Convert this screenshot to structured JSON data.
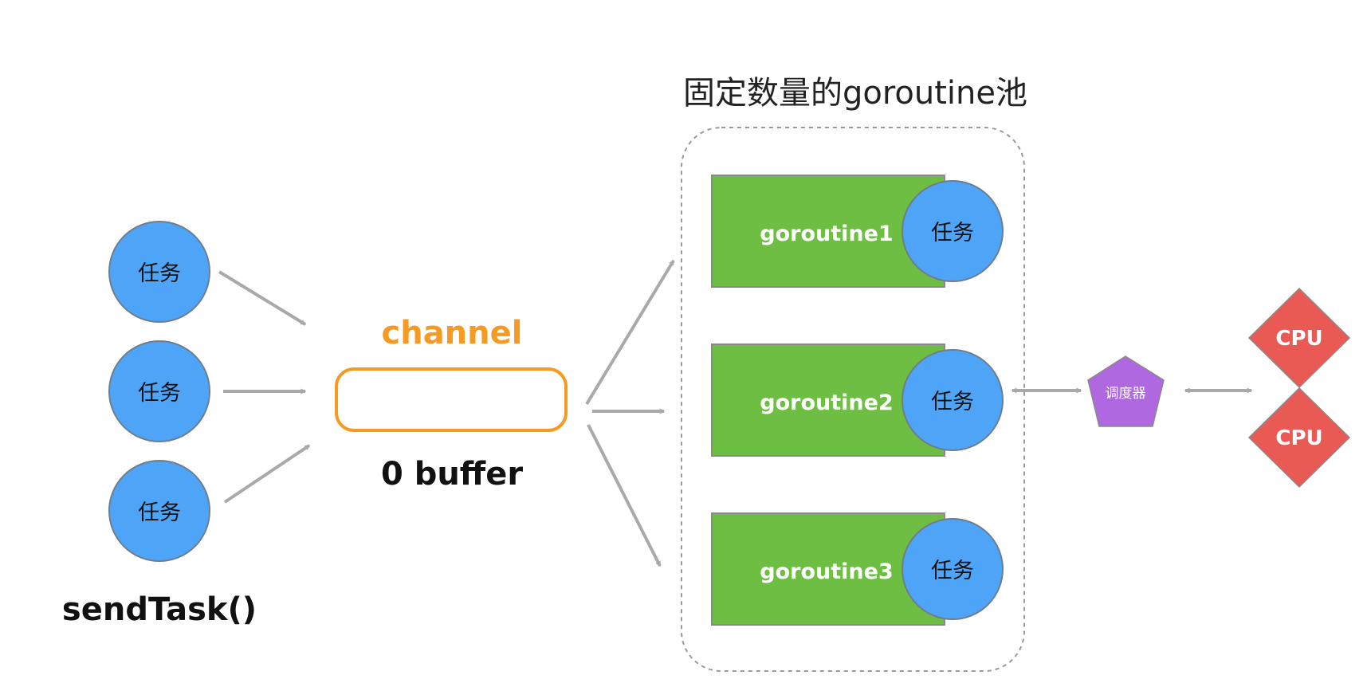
{
  "pool": {
    "title": "固定数量的goroutine池"
  },
  "producer": {
    "tasks": [
      "任务",
      "任务",
      "任务"
    ],
    "caption": "sendTask()"
  },
  "channel": {
    "label": "channel",
    "buffer_label": "0 buffer"
  },
  "workers": [
    {
      "name": "goroutine1",
      "task": "任务"
    },
    {
      "name": "goroutine2",
      "task": "任务"
    },
    {
      "name": "goroutine3",
      "task": "任务"
    }
  ],
  "scheduler": {
    "label": "调度器"
  },
  "cpus": [
    "CPU",
    "CPU"
  ],
  "colors": {
    "task_fill": "#4ea5f8",
    "task_stroke": "#6e7d8c",
    "worker_fill": "#6fbe44",
    "worker_stroke": "#8a8a8a",
    "channel_stroke": "#f59a23",
    "channel_label": "#f59a23",
    "scheduler_fill": "#b068e0",
    "cpu_fill": "#ea5a55",
    "arrow": "#a9a9a9",
    "pool_border": "#9a9a9a"
  }
}
